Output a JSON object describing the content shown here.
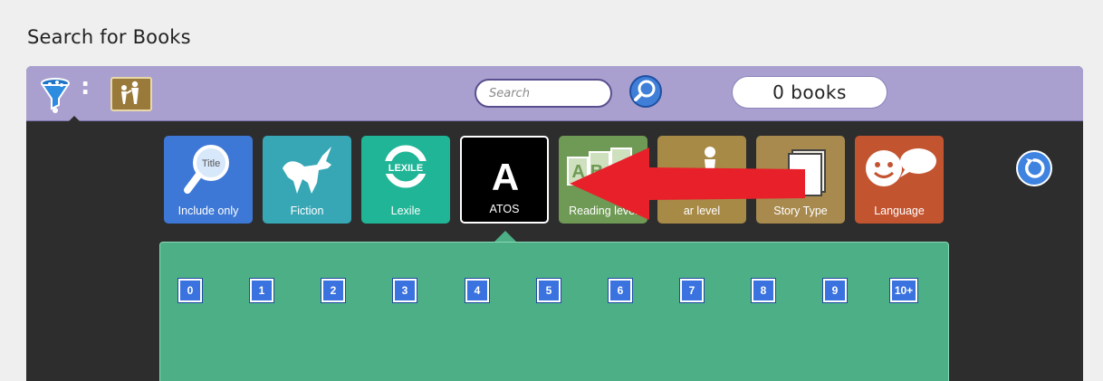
{
  "header": {
    "title": "Search for Books"
  },
  "toolbar": {
    "filter_icon": "funnel-icon",
    "audience_icon": "family-icon",
    "search_placeholder": "Search",
    "search_icon": "magnifier-icon",
    "book_count": "0 books"
  },
  "filters": [
    {
      "label": "Include only",
      "icon": "title-search-icon",
      "color": "#3d78d6"
    },
    {
      "label": "Fiction",
      "icon": "unicorn-icon",
      "color": "#37a7b6"
    },
    {
      "label": "Lexile",
      "icon": "lexile-logo-icon",
      "color": "#1fb596"
    },
    {
      "label": "ATOS",
      "icon": "letter-a-icon",
      "color": "#000000"
    },
    {
      "label": "Reading level",
      "icon": "abc-blocks-icon",
      "color": "#6f9a55"
    },
    {
      "label": "ar level",
      "icon": "person-icon",
      "color": "#a88a47"
    },
    {
      "label": "Story Type",
      "icon": "book-pages-icon",
      "color": "#a88a4e"
    },
    {
      "label": "Language",
      "icon": "speech-face-icon",
      "color": "#c35430"
    }
  ],
  "atos_tile": {
    "letter": "A"
  },
  "lexile_tile": {
    "logo_text": "LEXILE"
  },
  "include_tile": {
    "icon_text": "Title"
  },
  "reading_tile": {
    "icon_text": "ABC"
  },
  "levels": [
    "0",
    "1",
    "2",
    "3",
    "4",
    "5",
    "6",
    "7",
    "8",
    "9",
    "10+"
  ],
  "reset_icon": "reset-icon",
  "annotation": {
    "arrow_color": "#e8202a"
  }
}
